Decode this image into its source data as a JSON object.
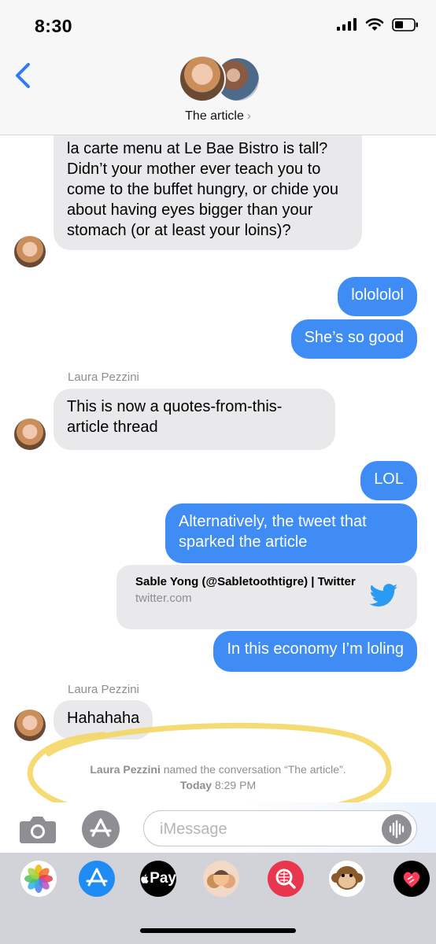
{
  "status_bar": {
    "time": "8:30"
  },
  "header": {
    "title": "The article",
    "chevron": "›",
    "back_icon": "chevron-left-icon"
  },
  "messages": [
    {
      "dir": "in",
      "text": "la carte menu at Le Bae Bistro is tall? Didn’t your mother ever teach you to come to the buffet hungry, or chide you about having eyes bigger than your stomach (or at least your loins)?"
    },
    {
      "dir": "out",
      "text": "lolololol"
    },
    {
      "dir": "out",
      "text": "She’s so good"
    },
    {
      "dir": "in",
      "sender": "Laura Pezzini",
      "text": "This is now a quotes-from-this-article thread"
    },
    {
      "dir": "out",
      "text": "LOL"
    },
    {
      "dir": "out",
      "text": "Alternatively, the tweet that sparked the article"
    },
    {
      "dir": "out",
      "text": "In this economy I’m loling"
    },
    {
      "dir": "in",
      "sender": "Laura Pezzini",
      "text": "Hahahaha"
    }
  ],
  "link_preview": {
    "title": "Sable Yong (@Sabletoothtigre) | Twitter",
    "domain": "twitter.com",
    "icon": "twitter-bird-icon"
  },
  "system_note": {
    "actor": "Laura Pezzini",
    "action": "named the conversation “The article”.",
    "day": "Today",
    "time": "8:29 PM"
  },
  "composer": {
    "placeholder": "iMessage",
    "value": ""
  },
  "app_drawer": {
    "apps": [
      "photos-icon",
      "app-store-icon",
      "apple-pay-icon",
      "memoji-icon",
      "web-search-icon",
      "animoji-monkey-icon",
      "digital-touch-icon"
    ],
    "pay_label": "Pay"
  },
  "colors": {
    "outgoing_bubble": "#3f8cf4",
    "incoming_bubble": "#e9e9eb",
    "tint": "#2f7cf6",
    "highlight": "#f5d35a"
  }
}
